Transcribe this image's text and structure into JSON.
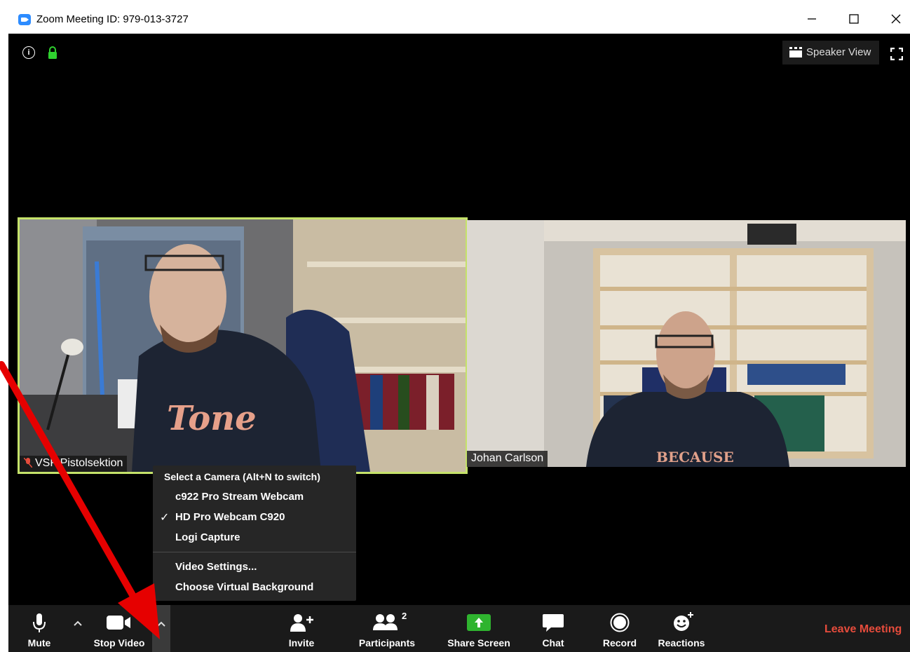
{
  "window": {
    "title": "Zoom Meeting ID: 979-013-3727"
  },
  "top": {
    "speaker_view_label": "Speaker View"
  },
  "participants": [
    {
      "name": "VSF Pistolsektion"
    },
    {
      "name": "Johan Carlson"
    }
  ],
  "camera_menu": {
    "header": "Select a Camera (Alt+N to switch)",
    "cameras": [
      {
        "label": "c922 Pro Stream Webcam",
        "selected": false
      },
      {
        "label": "HD Pro Webcam C920",
        "selected": true
      },
      {
        "label": "Logi Capture",
        "selected": false
      }
    ],
    "check_glyph": "✓",
    "video_settings": "Video Settings...",
    "virtual_background": "Choose Virtual Background"
  },
  "toolbar": {
    "mute": "Mute",
    "stop_video": "Stop Video",
    "invite": "Invite",
    "participants": "Participants",
    "participants_count": "2",
    "share_screen": "Share Screen",
    "chat": "Chat",
    "record": "Record",
    "reactions": "Reactions",
    "leave": "Leave Meeting"
  },
  "colors": {
    "accent": "#2d8cff",
    "active_speaker": "#c5e26a",
    "share": "#2fb42f",
    "leave": "#e74c3c",
    "annotation_arrow": "#e60000"
  }
}
